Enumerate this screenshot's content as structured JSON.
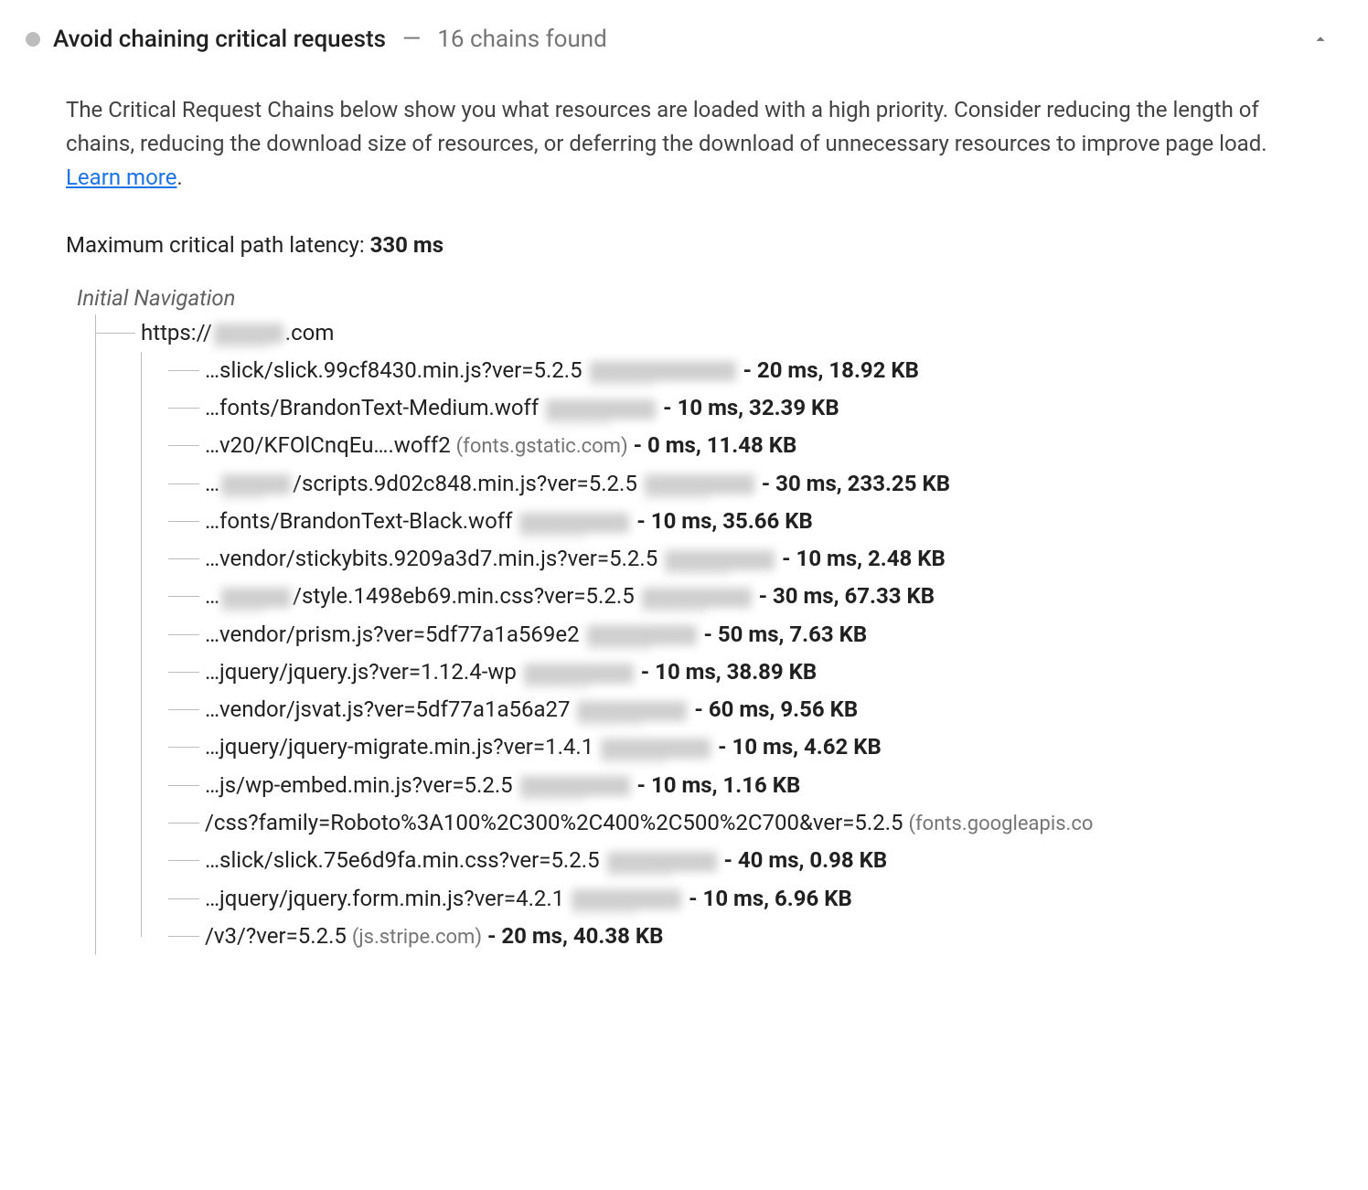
{
  "header": {
    "title": "Avoid chaining critical requests",
    "dash": "—",
    "subtitle": "16 chains found"
  },
  "description": {
    "text": "The Critical Request Chains below show you what resources are loaded with a high priority. Consider reducing the length of chains, reducing the download size of resources, or deferring the download of unnecessary resources to improve page load. ",
    "link_text": "Learn more",
    "period": "."
  },
  "latency": {
    "label": "Maximum critical path latency: ",
    "value": "330 ms"
  },
  "tree": {
    "root_label": "Initial Navigation",
    "root_url_prefix": "https://",
    "root_url_suffix": ".com",
    "items": [
      {
        "path": "…slick/slick.99cf8430.min.js?ver=5.2.5",
        "redacted": "lg",
        "host": "",
        "metrics": "- 20 ms, 18.92 KB"
      },
      {
        "path": "…fonts/BrandonText-Medium.woff",
        "redacted": "md",
        "host": "",
        "metrics": "- 10 ms, 32.39 KB"
      },
      {
        "path": "…v20/KFOlCnqEu….woff2",
        "redacted": "",
        "host": "(fonts.gstatic.com)",
        "metrics": "- 0 ms, 11.48 KB"
      },
      {
        "pre_redacted": "sm",
        "path": "/scripts.9d02c848.min.js?ver=5.2.5",
        "redacted": "md",
        "host": "",
        "metrics": "- 30 ms, 233.25 KB",
        "ellipsis_pre": true
      },
      {
        "path": "…fonts/BrandonText-Black.woff",
        "redacted": "md",
        "host": "",
        "metrics": "- 10 ms, 35.66 KB"
      },
      {
        "path": "…vendor/stickybits.9209a3d7.min.js?ver=5.2.5",
        "redacted": "md",
        "host": "",
        "metrics": "- 10 ms, 2.48 KB"
      },
      {
        "pre_redacted": "sm",
        "path": "/style.1498eb69.min.css?ver=5.2.5",
        "redacted": "md",
        "host": "",
        "metrics": "- 30 ms, 67.33 KB",
        "ellipsis_pre": true
      },
      {
        "path": "…vendor/prism.js?ver=5df77a1a569e2",
        "redacted": "md",
        "host": "",
        "metrics": "- 50 ms, 7.63 KB"
      },
      {
        "path": "…jquery/jquery.js?ver=1.12.4-wp",
        "redacted": "md",
        "host": "",
        "metrics": "- 10 ms, 38.89 KB"
      },
      {
        "path": "…vendor/jsvat.js?ver=5df77a1a56a27",
        "redacted": "md",
        "host": "",
        "metrics": "- 60 ms, 9.56 KB"
      },
      {
        "path": "…jquery/jquery-migrate.min.js?ver=1.4.1",
        "redacted": "md",
        "host": "",
        "metrics": "- 10 ms, 4.62 KB"
      },
      {
        "path": "…js/wp-embed.min.js?ver=5.2.5",
        "redacted": "md",
        "host": "",
        "metrics": "- 10 ms, 1.16 KB"
      },
      {
        "path": "/css?family=Roboto%3A100%2C300%2C400%2C500%2C700&ver=5.2.5",
        "redacted": "",
        "host": "(fonts.googleapis.co",
        "metrics": ""
      },
      {
        "path": "…slick/slick.75e6d9fa.min.css?ver=5.2.5",
        "redacted": "md",
        "host": "",
        "metrics": "- 40 ms, 0.98 KB"
      },
      {
        "path": "…jquery/jquery.form.min.js?ver=4.2.1",
        "redacted": "md",
        "host": "",
        "metrics": "- 10 ms, 6.96 KB"
      },
      {
        "path": "/v3/?ver=5.2.5",
        "redacted": "",
        "host": "(js.stripe.com)",
        "metrics": "- 20 ms, 40.38 KB"
      }
    ]
  }
}
